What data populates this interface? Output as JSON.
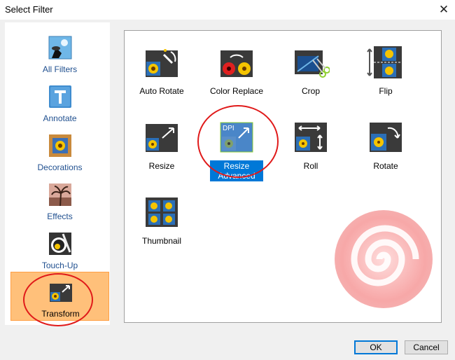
{
  "window": {
    "title": "Select Filter",
    "close_glyph": "✕"
  },
  "sidebar": {
    "items": [
      {
        "label": "All Filters",
        "icon": "all-filters-icon"
      },
      {
        "label": "Annotate",
        "icon": "annotate-icon"
      },
      {
        "label": "Decorations",
        "icon": "decorations-icon"
      },
      {
        "label": "Effects",
        "icon": "effects-icon"
      },
      {
        "label": "Touch-Up",
        "icon": "touch-up-icon"
      },
      {
        "label": "Transform",
        "icon": "transform-icon",
        "selected": true
      }
    ]
  },
  "filters": [
    {
      "label": "Auto Rotate",
      "icon": "auto-rotate-icon"
    },
    {
      "label": "Color Replace",
      "icon": "color-replace-icon"
    },
    {
      "label": "Crop",
      "icon": "crop-icon"
    },
    {
      "label": "Flip",
      "icon": "flip-icon"
    },
    {
      "label": "Resize",
      "icon": "resize-icon"
    },
    {
      "label": "Resize Advanced",
      "icon": "resize-advanced-icon",
      "selected": true,
      "icon_text": "DPI"
    },
    {
      "label": "Roll",
      "icon": "roll-icon"
    },
    {
      "label": "Rotate",
      "icon": "rotate-icon"
    },
    {
      "label": "Thumbnail",
      "icon": "thumbnail-icon"
    }
  ],
  "buttons": {
    "ok": "OK",
    "cancel": "Cancel"
  },
  "colors": {
    "selection_bg": "#ffc07a",
    "highlight": "#0078d7",
    "annotation_red": "#e01a1a",
    "sidebar_label": "#1f4f8f"
  }
}
